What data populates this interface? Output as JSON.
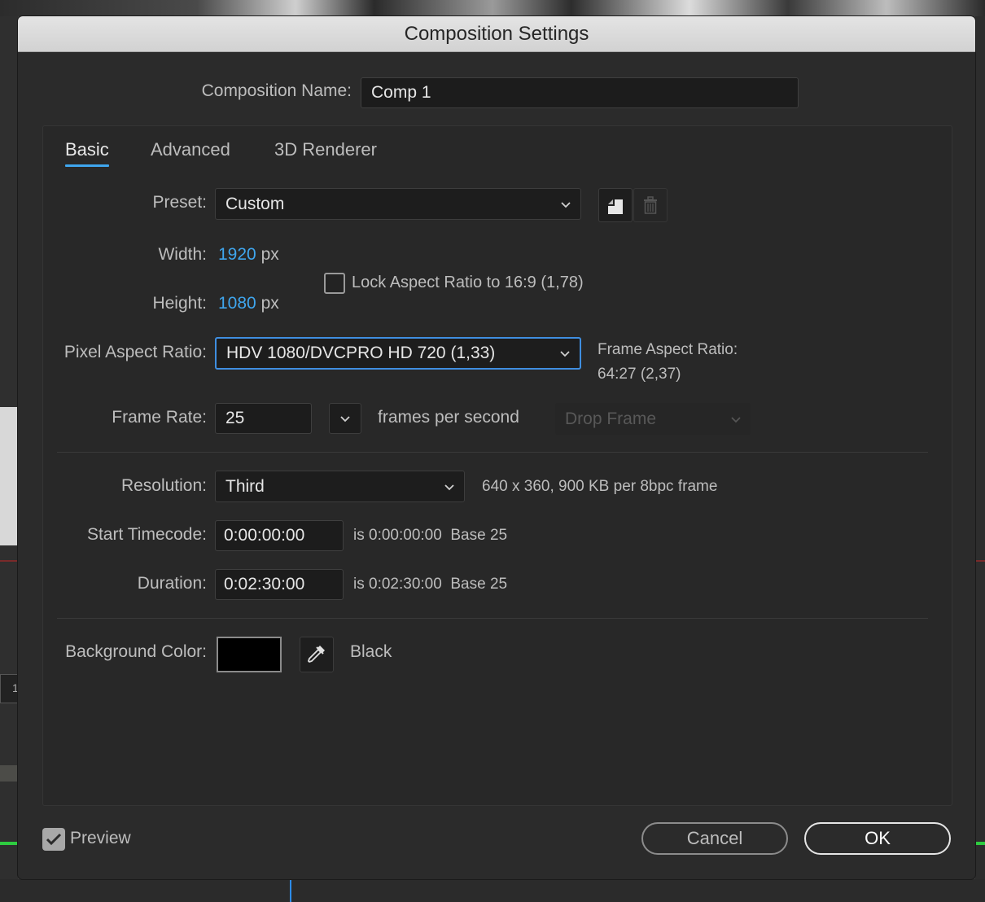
{
  "dialog": {
    "title": "Composition Settings"
  },
  "comp_name": {
    "label": "Composition Name:",
    "value": "Comp 1"
  },
  "tabs": [
    {
      "label": "Basic",
      "active": true
    },
    {
      "label": "Advanced",
      "active": false
    },
    {
      "label": "3D Renderer",
      "active": false
    }
  ],
  "preset": {
    "label": "Preset:",
    "value": "Custom",
    "save_icon": "save-preset-icon",
    "delete_icon": "trash-icon"
  },
  "width": {
    "label": "Width:",
    "value": "1920",
    "unit": "px"
  },
  "height": {
    "label": "Height:",
    "value": "1080",
    "unit": "px"
  },
  "lock_aspect": {
    "label": "Lock Aspect Ratio to 16:9 (1,78)",
    "checked": false
  },
  "pixel_aspect": {
    "label": "Pixel Aspect Ratio:",
    "value": "HDV 1080/DVCPRO HD 720 (1,33)"
  },
  "frame_aspect": {
    "label": "Frame Aspect Ratio:",
    "value": "64:27 (2,37)"
  },
  "frame_rate": {
    "label": "Frame Rate:",
    "value": "25",
    "unit": "frames per second",
    "drop_frame": "Drop Frame"
  },
  "resolution": {
    "label": "Resolution:",
    "value": "Third",
    "info": "640 x 360, 900 KB per 8bpc frame"
  },
  "start_timecode": {
    "label": "Start Timecode:",
    "value": "0:00:00:00",
    "is_text": "is 0:00:00:00",
    "base": "Base 25"
  },
  "duration": {
    "label": "Duration:",
    "value": "0:02:30:00",
    "is_text": "is 0:02:30:00",
    "base": "Base 25"
  },
  "background": {
    "label": "Background Color:",
    "color": "#000000",
    "name": "Black",
    "eyedropper_icon": "eyedropper-icon"
  },
  "footer": {
    "preview_label": "Preview",
    "preview_checked": true,
    "cancel_label": "Cancel",
    "ok_label": "OK"
  },
  "colors": {
    "accent": "#3fa6ee",
    "dialog_bg": "#2b2b2b",
    "field_bg": "#1c1c1c"
  }
}
